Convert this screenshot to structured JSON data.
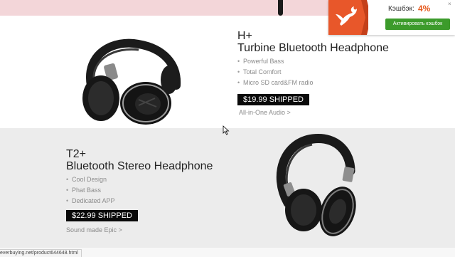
{
  "product1": {
    "name_line1": "H+",
    "name_line2": "Turbine Bluetooth Headphone",
    "features": [
      "Powerful Bass",
      "Total Comfort",
      "Micro SD card&FM radio"
    ],
    "price_button": "$19.99 SHIPPED",
    "link": "All-in-One Audio >"
  },
  "product2": {
    "name_line1": "T2+",
    "name_line2": "Bluetooth Stereo Headphone",
    "features": [
      "Cool Design",
      "Phat Bass",
      "Dedicated APP"
    ],
    "price_button": "$22.99 SHIPPED",
    "link": "Sound made Epic >"
  },
  "cashback": {
    "label": "Кэшбэк:",
    "percent": "4%",
    "button": "Активировать кэшбэк",
    "close": "×",
    "colors": {
      "accent": "#e65a1e",
      "button": "#3c9b2b"
    }
  },
  "status_bar": {
    "url": "everbuying.net/product644648.html"
  }
}
